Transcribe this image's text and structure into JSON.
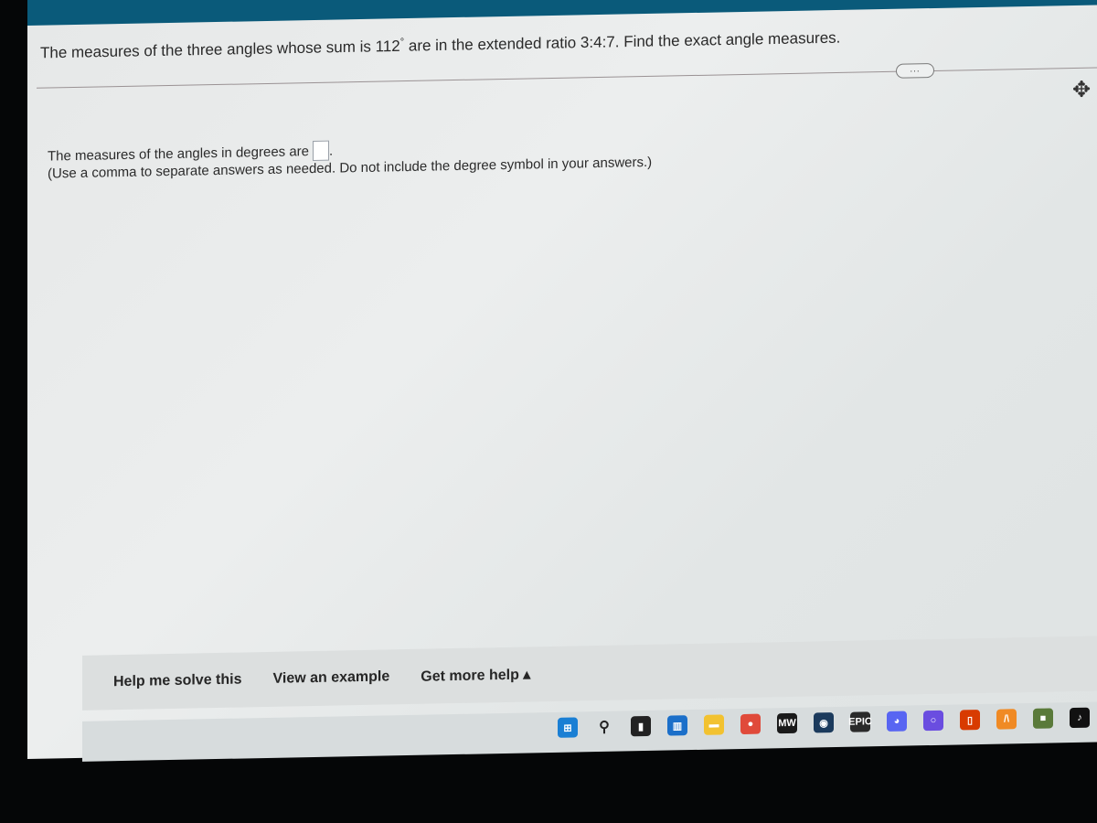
{
  "question": {
    "text_before": "The measures of the three angles whose sum is 112",
    "degree_symbol": "°",
    "text_after": " are in the extended ratio 3:4:7. Find the exact angle measures."
  },
  "more_button_label": "...",
  "answer": {
    "prompt": "The measures of the angles in degrees are",
    "value": "",
    "trailing": ".",
    "hint": "(Use a comma to separate answers as needed. Do not include the degree symbol in your answers.)"
  },
  "help_links": {
    "help_me_solve": "Help me solve this",
    "view_example": "View an example",
    "get_more_help": "Get more help ▴"
  },
  "taskbar": {
    "icons": [
      {
        "name": "windows-start-icon",
        "glyph": "⊞",
        "color": "#1a7fd4"
      },
      {
        "name": "search-icon",
        "glyph": "⚲",
        "color": "#d7dcdd"
      },
      {
        "name": "task-view-icon",
        "glyph": "▮",
        "color": "#222222"
      },
      {
        "name": "widgets-icon",
        "glyph": "▥",
        "color": "#1b6fc9"
      },
      {
        "name": "file-explorer-icon",
        "glyph": "▬",
        "color": "#f2c230"
      },
      {
        "name": "chrome-icon",
        "glyph": "●",
        "color": "#e04a3a"
      },
      {
        "name": "mw-game-icon",
        "glyph": "MW",
        "color": "#1a1a1a"
      },
      {
        "name": "steam-icon",
        "glyph": "◉",
        "color": "#1b3a5c"
      },
      {
        "name": "epic-games-icon",
        "glyph": "EPIC",
        "color": "#2a2a2a"
      },
      {
        "name": "discord-icon",
        "glyph": "◕",
        "color": "#5865f2"
      },
      {
        "name": "app-circle-icon",
        "glyph": "○",
        "color": "#6a4de0"
      },
      {
        "name": "office-icon",
        "glyph": "▯",
        "color": "#d83b01"
      },
      {
        "name": "fl-studio-icon",
        "glyph": "/\\",
        "color": "#f08a24"
      },
      {
        "name": "minecraft-icon",
        "glyph": "■",
        "color": "#5a7a3a"
      },
      {
        "name": "tiktok-icon",
        "glyph": "♪",
        "color": "#111111"
      }
    ]
  }
}
